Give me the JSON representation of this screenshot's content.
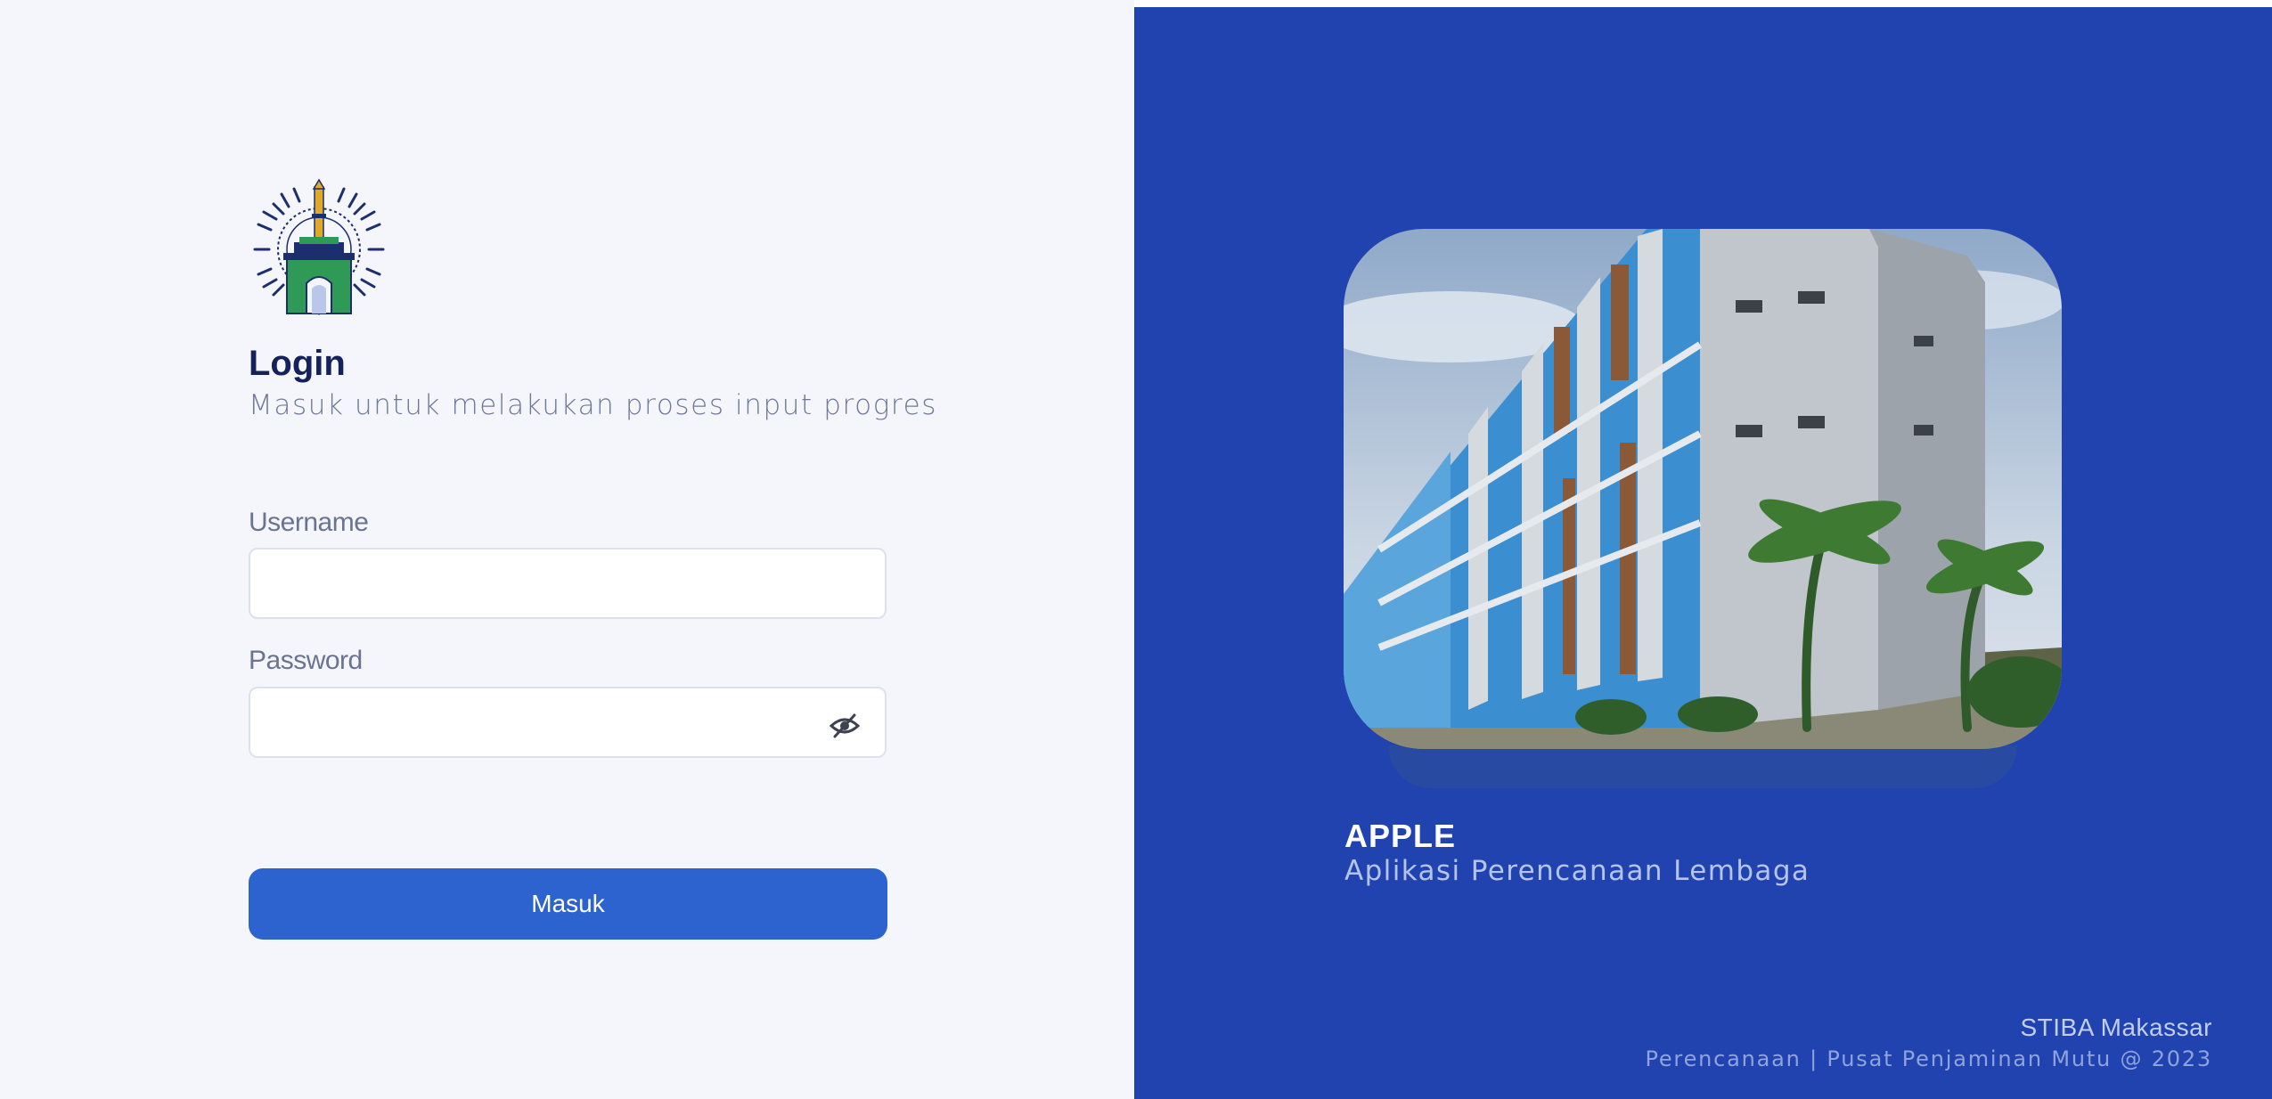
{
  "login": {
    "logo_icon": "institution-logo-icon",
    "title": "Login",
    "subtitle": "Masuk untuk melakukan proses input progres",
    "username_label": "Username",
    "username_value": "",
    "password_label": "Password",
    "password_value": "",
    "password_toggle_icon": "eye-slash-icon",
    "submit_label": "Masuk"
  },
  "hero": {
    "photo_icon": "campus-building-photo",
    "app_name": "APPLE",
    "app_description": "Aplikasi Perencanaan Lembaga",
    "footer_org": "STIBA Makassar",
    "footer_credit": "Perencanaan | Pusat Penjaminan Mutu @ 2023"
  },
  "colors": {
    "left_background": "#f5f6fb",
    "right_background": "#2043b0",
    "primary_button": "#2d63cf",
    "title_text": "#14215a"
  }
}
